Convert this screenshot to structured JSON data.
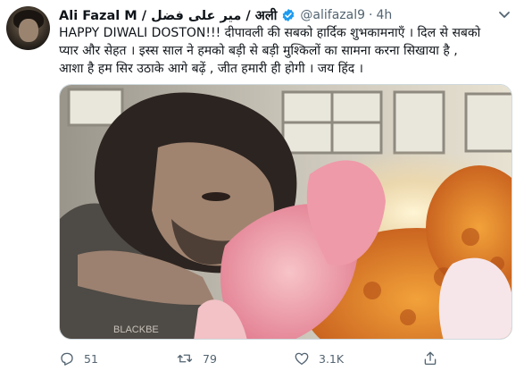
{
  "tweet": {
    "name": "Ali Fazal M / میر علی فضل / अली",
    "handle": "@alifazal9",
    "separator": "·",
    "time": "4h",
    "text_lines": [
      "HAPPY DIWALI DOSTON!!! दीपावली की सबको हार्दिक शुभकामनाएँ । दिल से सबको",
      "प्यार और सेहत । इस्स साल ने हमको बड़ी से बड़ी मुश्किलों का सामना करना सिखाया है ,",
      "आशा है हम सिर उठाके आगे बढ़ें , जीत हमारी ही होगी । जय हिंद ।"
    ],
    "verified_color": "#1d9bf0",
    "media_shirt_text": "BLACKBE"
  },
  "actions": {
    "reply": {
      "icon": "reply-icon",
      "count": "51"
    },
    "retweet": {
      "icon": "retweet-icon",
      "count": "79"
    },
    "like": {
      "icon": "heart-icon",
      "count": "3.1K"
    },
    "share": {
      "icon": "share-icon",
      "count": ""
    }
  },
  "colors": {
    "text": "#0f1419",
    "secondary": "#536471",
    "verified": "#1d9bf0",
    "border": "#cfd9de"
  }
}
